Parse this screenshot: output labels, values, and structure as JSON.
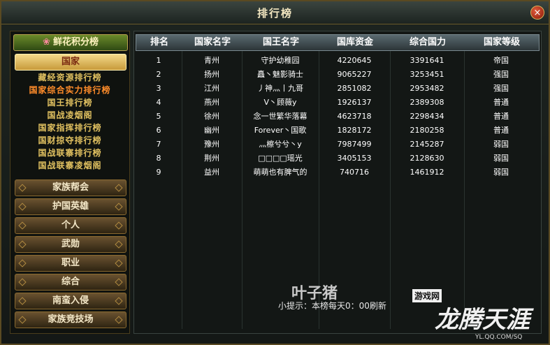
{
  "window": {
    "title": "排行榜"
  },
  "sidebar": {
    "flower_tab": "鲜花积分榜",
    "active_category": "国家",
    "subitems": [
      {
        "label": "藏经资源排行榜",
        "active": false
      },
      {
        "label": "国家综合实力排行榜",
        "active": true
      },
      {
        "label": "国王排行榜",
        "active": false
      },
      {
        "label": "国战凌烟阁",
        "active": false
      },
      {
        "label": "国家指挥排行榜",
        "active": false
      },
      {
        "label": "国财掠夺排行榜",
        "active": false
      },
      {
        "label": "国战联寨排行榜",
        "active": false
      },
      {
        "label": "国战联寨凌烟阁",
        "active": false
      }
    ],
    "categories": [
      "家族帮会",
      "护国英雄",
      "个人",
      "武勋",
      "职业",
      "综合",
      "南蛮入侵",
      "家族竞技场"
    ]
  },
  "table": {
    "headers": [
      "排名",
      "国家名字",
      "国王名字",
      "国库资金",
      "综合国力",
      "国家等级"
    ],
    "rows": [
      [
        "1",
        "青州",
        "守护幼稚园",
        "4220645",
        "3391641",
        "帝国"
      ],
      [
        "2",
        "扬州",
        "矗丶魅影骑士",
        "9065227",
        "3253451",
        "强国"
      ],
      [
        "3",
        "江州",
        "丿神灬丨九哥",
        "2851082",
        "2953482",
        "强国"
      ],
      [
        "4",
        "燕州",
        "V丶顾薇y",
        "1926137",
        "2389308",
        "普通"
      ],
      [
        "5",
        "徐州",
        "念一世繁华落幕",
        "4623718",
        "2298434",
        "普通"
      ],
      [
        "6",
        "幽州",
        "Forever丶国歌",
        "1828172",
        "2180258",
        "普通"
      ],
      [
        "7",
        "豫州",
        "灬檫兮兮丶y",
        "7987499",
        "2145287",
        "弱国"
      ],
      [
        "8",
        "荆州",
        "□□□□瑶光",
        "3405153",
        "2128630",
        "弱国"
      ],
      [
        "9",
        "益州",
        "萌萌也有脾气的",
        "740716",
        "1461912",
        "弱国"
      ]
    ]
  },
  "tip": "小提示：本榜每天0：00刷新",
  "watermark": {
    "main": "叶子猪",
    "sub": "游戏网",
    "game": "龙腾天涯",
    "url": "YL.QQ.COM/SQ"
  },
  "close_label": "×"
}
